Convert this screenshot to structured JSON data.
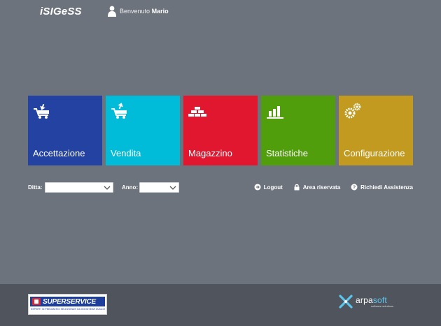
{
  "header": {
    "logo": "iSIGeSS",
    "welcome_prefix": "Benvenuto",
    "user_name": "Mario"
  },
  "tiles": [
    {
      "label": "Accettazione",
      "color": "#2442a2",
      "icon": "cart-in-icon"
    },
    {
      "label": "Vendita",
      "color": "#00bcd8",
      "icon": "cart-out-icon"
    },
    {
      "label": "Magazzino",
      "color": "#e1172f",
      "icon": "bricks-icon"
    },
    {
      "label": "Statistiche",
      "color": "#519e0c",
      "icon": "bar-chart-icon"
    },
    {
      "label": "Configurazione",
      "color": "#c19a1f",
      "icon": "gears-icon"
    }
  ],
  "filters": {
    "ditta_label": "Ditta:",
    "ditta_value": "",
    "anno_label": "Anno:",
    "anno_value": ""
  },
  "links": {
    "logout": "Logout",
    "area": "Area riservata",
    "assistenza": "Richiedi Assistenza"
  },
  "footer": {
    "partner_logo": "SUPERSERVICE",
    "partner_tagline": "ESPERTI IN PNEUMATICI SELEZIONATI DA GOODYEAR DUNLOP",
    "vendor_name_a": "arpa",
    "vendor_name_b": "soft",
    "vendor_tagline": "software solutions"
  }
}
